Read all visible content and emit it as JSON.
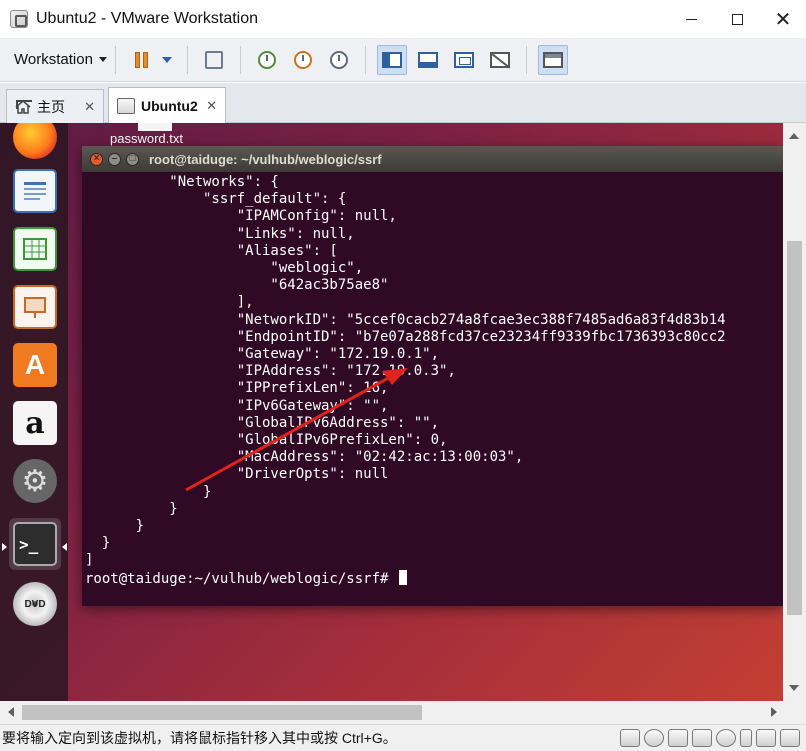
{
  "window": {
    "title": "Ubuntu2 - VMware Workstation",
    "minimize_glyph": "",
    "maximize_glyph": "",
    "close_glyph": "✕"
  },
  "toolbar": {
    "menu_label": "Workstation",
    "icons": [
      "pause-icon",
      "send-ctrl-alt-del-icon",
      "snapshot-icon",
      "revert-snapshot-icon",
      "snapshot-manager-icon",
      "show-library-icon",
      "thumbnail-bar-icon",
      "full-screen-icon",
      "unity-icon",
      "console-view-icon"
    ]
  },
  "tabs": [
    {
      "label": "主页",
      "icon": "home-icon",
      "active": false
    },
    {
      "label": "Ubuntu2",
      "icon": "vm-icon",
      "active": true
    }
  ],
  "desktop": {
    "file_label": "password.txt"
  },
  "launcher": {
    "apps": [
      "firefox",
      "libreoffice-writer",
      "libreoffice-calc",
      "libreoffice-impress",
      "ubuntu-software",
      "amazon",
      "system-settings",
      "terminal",
      "dvd"
    ],
    "store_glyph": "A",
    "amazon_glyph": "a",
    "settings_glyph": "⚙",
    "terminal_glyph": ">_",
    "dvd_glyph": "DVD"
  },
  "terminal": {
    "title": "root@taiduge: ~/vulhub/weblogic/ssrf",
    "lines": [
      "          \"Networks\": {",
      "              \"ssrf_default\": {",
      "                  \"IPAMConfig\": null,",
      "                  \"Links\": null,",
      "                  \"Aliases\": [",
      "                      \"weblogic\",",
      "                      \"642ac3b75ae8\"",
      "                  ],",
      "                  \"NetworkID\": \"5ccef0cacb274a8fcae3ec388f7485ad6a83f4d83b14",
      "                  \"EndpointID\": \"b7e07a288fcd37ce23234ff9339fbc1736393c80cc2",
      "                  \"Gateway\": \"172.19.0.1\",",
      "                  \"IPAddress\": \"172.19.0.3\",",
      "                  \"IPPrefixLen\": 16,",
      "                  \"IPv6Gateway\": \"\",",
      "                  \"GlobalIPv6Address\": \"\",",
      "                  \"GlobalIPv6PrefixLen\": 0,",
      "                  \"MacAddress\": \"02:42:ac:13:00:03\",",
      "                  \"DriverOpts\": null",
      "              }",
      "          }",
      "      }",
      "  }",
      "]"
    ],
    "prompt": "root@taiduge:~/vulhub/weblogic/ssrf# ",
    "annotation_color": "#e0231c"
  },
  "statusbar": {
    "text": "要将输入定向到该虚拟机，请将鼠标指针移入其中或按 Ctrl+G。"
  },
  "colors": {
    "terminal_bg": "#300a24",
    "ubuntu_accent": "#e65a2e",
    "toolbar_bg": "#eef0f4"
  }
}
